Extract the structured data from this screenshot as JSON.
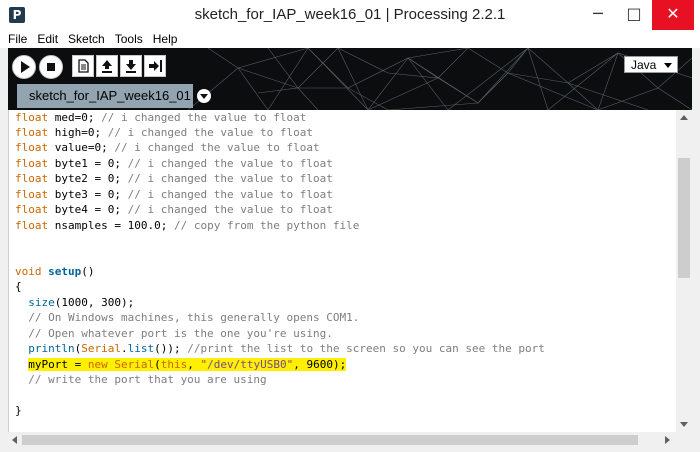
{
  "window": {
    "title": "sketch_for_IAP_week16_01 | Processing 2.2.1",
    "icon_letter": "P",
    "controls": {
      "minimize": "─",
      "maximize": "□",
      "close": "✕"
    }
  },
  "menu": [
    "File",
    "Edit",
    "Sketch",
    "Tools",
    "Help"
  ],
  "toolbar": {
    "buttons": [
      "play-icon",
      "stop-icon",
      "new-icon",
      "open-icon",
      "save-icon",
      "export-icon"
    ],
    "mode": "Java"
  },
  "tab": {
    "label": "sketch_for_IAP_week16_01"
  },
  "colors": {
    "keyword": "#cc6600",
    "function": "#006699",
    "comment": "#7e7e7e",
    "string": "#7d4793",
    "highlight": "#ffef00",
    "toolbar_bg": "#0b0d0f",
    "tab_bg": "#92a4b0"
  },
  "code": {
    "l1": {
      "kw": "float",
      "rest": " med=0; ",
      "cm": "// i changed the value to float"
    },
    "l2": {
      "kw": "float",
      "rest": " high=0; ",
      "cm": "// i changed the value to float"
    },
    "l3": {
      "kw": "float",
      "rest": " value=0; ",
      "cm": "// i changed the value to float"
    },
    "l4": {
      "kw": "float",
      "rest": " byte1 = 0; ",
      "cm": "// i changed the value to float"
    },
    "l5": {
      "kw": "float",
      "rest": " byte2 = 0; ",
      "cm": "// i changed the value to float"
    },
    "l6": {
      "kw": "float",
      "rest": " byte3 = 0; ",
      "cm": "// i changed the value to float"
    },
    "l7": {
      "kw": "float",
      "rest": " byte4 = 0; ",
      "cm": "// i changed the value to float"
    },
    "l8": {
      "kw": "float",
      "rest": " nsamples = 100.0; ",
      "cm": "// copy from the python file"
    },
    "l9": {
      "kw": "void",
      "sp": " ",
      "fn": "setup",
      "rest": "()"
    },
    "l10": "{",
    "l11": {
      "indent": "  ",
      "fn": "size",
      "rest": "(1000, 300);"
    },
    "l12": "  // On Windows machines, this generally opens COM1.",
    "l13": "  // Open whatever port is the one you're using.",
    "l14": {
      "indent": "  ",
      "fn": "println",
      "p1": "(",
      "cls": "Serial",
      "p2": ".",
      "fn2": "list",
      "rest": "()); ",
      "cm": "//print the list to the screen so you can see the port"
    },
    "l15": {
      "indent": "  ",
      "var": "myPort",
      "eq": " = ",
      "kw": "new",
      "sp": " ",
      "cls": "Serial",
      "p1": "(",
      "kw2": "this",
      "p2": ", ",
      "str": "\"/dev/ttyUSB0\"",
      "rest": ", 9600);"
    },
    "l16": "  // write the port that you are using",
    "l17": "}"
  }
}
